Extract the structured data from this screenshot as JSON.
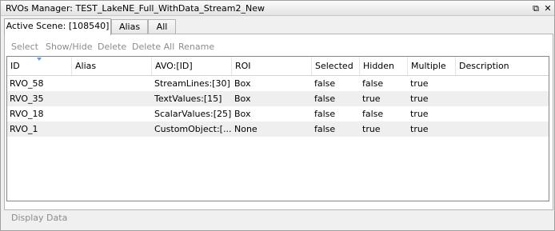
{
  "window": {
    "title": "RVOs Manager: TEST_LakeNE_Full_WithData_Stream2_New",
    "restore_glyph": "⧉",
    "close_glyph": "✕"
  },
  "tabs": [
    {
      "label": "Active Scene: [108540]",
      "active": true
    },
    {
      "label": "Alias",
      "active": false
    },
    {
      "label": "All",
      "active": false
    }
  ],
  "toolbar": {
    "select": "Select",
    "show_hide": "Show/Hide",
    "delete": "Delete",
    "delete_all": "Delete All",
    "rename": "Rename"
  },
  "table": {
    "columns": [
      "ID",
      "Alias",
      "AVO:[ID]",
      "ROI",
      "Selected",
      "Hidden",
      "Multiple",
      "Description"
    ],
    "sorted_column": "ID",
    "rows": [
      {
        "id": "RVO_58",
        "alias": "",
        "avo": "StreamLines:[30]",
        "roi": "Box",
        "selected": "false",
        "hidden": "false",
        "multiple": "true",
        "description": ""
      },
      {
        "id": "RVO_35",
        "alias": "",
        "avo": "TextValues:[15]",
        "roi": "Box",
        "selected": "false",
        "hidden": "true",
        "multiple": "true",
        "description": ""
      },
      {
        "id": "RVO_18",
        "alias": "",
        "avo": "ScalarValues:[25]",
        "roi": "Box",
        "selected": "false",
        "hidden": "false",
        "multiple": "true",
        "description": ""
      },
      {
        "id": "RVO_1",
        "alias": "",
        "avo": "CustomObject:[...",
        "roi": "None",
        "selected": "false",
        "hidden": "true",
        "multiple": "true",
        "description": ""
      }
    ]
  },
  "footer": {
    "display_data": "Display Data"
  },
  "colors": {
    "disabled_text": "#8c8c8c",
    "alt_row": "#efefef",
    "sort_indicator": "#569de5"
  }
}
